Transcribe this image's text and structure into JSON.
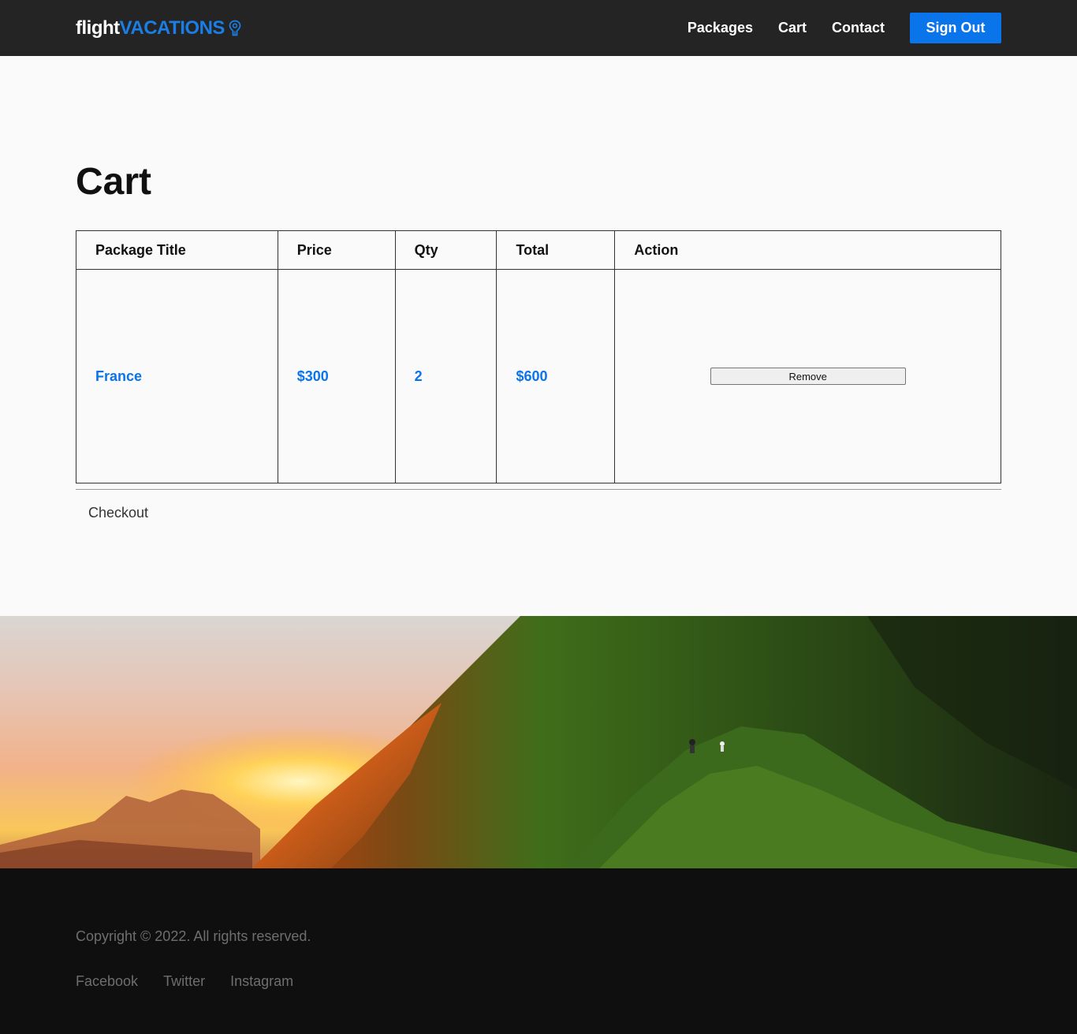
{
  "header": {
    "logo_part1": "flight",
    "logo_part2": "VACATIONS",
    "logo_icon": "map-pin-icon",
    "nav": [
      "Packages",
      "Cart",
      "Contact"
    ],
    "signout_label": "Sign Out"
  },
  "main": {
    "title": "Cart",
    "table": {
      "headers": [
        "Package Title",
        "Price",
        "Qty",
        "Total",
        "Action"
      ],
      "rows": [
        {
          "title": "France",
          "price": "$300",
          "qty": "2",
          "total": "$600",
          "action": "Remove"
        }
      ]
    },
    "checkout_label": "Checkout"
  },
  "footer": {
    "copyright": "Copyright © 2022. All rights reserved.",
    "social": [
      "Facebook",
      "Twitter",
      "Instagram"
    ]
  },
  "colors": {
    "accent": "#0a74ea",
    "header_bg": "#242424",
    "footer_bg": "#0f0f0f"
  }
}
